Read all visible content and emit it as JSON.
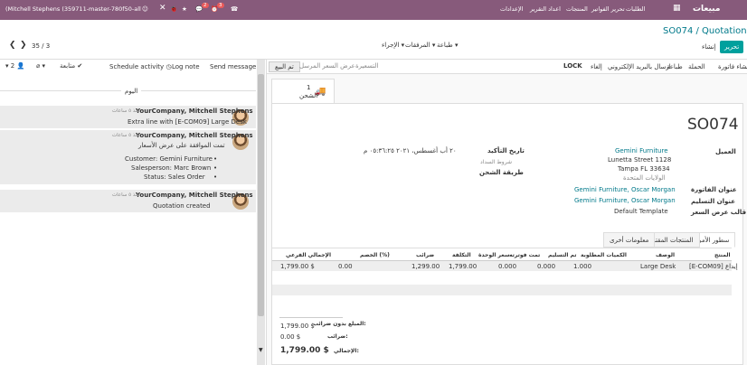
{
  "topbar": {
    "brand": "مبيعات",
    "menu": [
      "الطلبات",
      "تحرير الفواتير",
      "المنتجات",
      "اعداد التقرير",
      "الإعدادات"
    ],
    "user": "(Mitchell Stephens (359711-master-780f50-all",
    "badges": [
      "2",
      "3"
    ]
  },
  "control_panel": {
    "breadcrumb": "SO074 / Quotations",
    "edit_label": "تحرير",
    "create_label": "إنشاء",
    "print_label": "طباعة",
    "attachments_label": "المرفقات",
    "action_label": "الإجراء",
    "pager": "35 / 3"
  },
  "status_bar": {
    "buttons": [
      "إنشاء فاتورة",
      "الحملة",
      "طباعة",
      "ارسال بالبريد الإلكتروني",
      "إلغاء",
      "LOCK"
    ],
    "stages": [
      "تم البيع",
      "عرض السعر المرسل",
      "التسعيرة"
    ]
  },
  "chatter": {
    "send_message": "Send message",
    "log_note": "Log note",
    "schedule_activity": "Schedule activity",
    "follow": "متابعة",
    "followers_count": "2",
    "date_separator": "اليوم",
    "messages": [
      {
        "author": "YourCompany, Mitchell Stephens",
        "time": "منذ ٥ ساعات -",
        "body": "Extra line with [E-COM09] Large Desk"
      },
      {
        "author": "YourCompany, Mitchell Stephens",
        "time": "منذ ٥ ساعات -",
        "body": "تمت الموافقة على عرض الأسعار",
        "details": [
          "Customer: Gemini Furniture",
          "Salesperson: Marc Brown",
          "Status: Sales Order"
        ]
      },
      {
        "author": "YourCompany, Mitchell Stephens",
        "time": "منذ ٥ ساعات -",
        "body": "Quotation created"
      }
    ]
  },
  "form": {
    "smart_button_count": "1",
    "smart_button_label": "الشحن",
    "title": "SO074",
    "customer_label": "العميل",
    "customer_name": "Gemini Furniture",
    "address1": "Lunetta Street 1128",
    "address2": "Tampa FL 33634",
    "country": "الولايات المتحدة",
    "invoice_addr_label": "عنوان الفاتورة",
    "invoice_addr": "Gemini Furniture, Oscar Morgan",
    "delivery_addr_label": "عنوان التسليم",
    "delivery_addr": "Gemini Furniture, Oscar Morgan",
    "template_label": "قالب عرض السعر",
    "template": "Default Template",
    "confirm_date_label": "تاريخ التأكيد",
    "confirm_date": "٢٠ أب أغسطس، ٢٠٢١ ٠٥:٣٦:٢٥ م",
    "payment_terms_label": "شروط السداد",
    "shipping_policy_label": "طريقة الشحن"
  },
  "tabs": [
    "سطور الأمر",
    "المنتجات المقترحة",
    "معلومات أخرى"
  ],
  "order_lines": {
    "headers": [
      "المنتج",
      "الوصف",
      "الكميات المطلوبة",
      "تم التسليم",
      "تمت فوترته",
      "سعر الوحدة",
      "التكلفة",
      "ضرائب",
      "الخصم (%)",
      "الإجمالي الفرعي"
    ],
    "rows": [
      [
        "[E-COM09] إيداع",
        "Large Desk",
        "1.000",
        "0.000",
        "0.000",
        "1,799.00",
        "1,299.00",
        "",
        "0.00",
        "1,799.00 $"
      ]
    ]
  },
  "totals": {
    "untaxed_label": "المبلغ بدون ضرائب:",
    "untaxed": "1,799.00 $",
    "taxes_label": "ضرائب:",
    "taxes": "0.00 $",
    "total_label": "الإجمالي:",
    "total": "1,799.00 $"
  },
  "colors": {
    "brand": "#875a7b",
    "primary": "#00a09d",
    "link": "#00798a"
  }
}
